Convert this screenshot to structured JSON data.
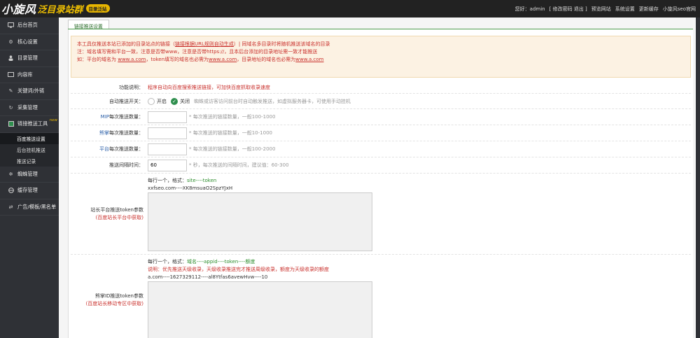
{
  "header": {
    "logo_main": "小旋风",
    "logo_sub": "泛目录站群",
    "logo_badge": "目录泛站",
    "links": [
      "您好：admin",
      "[ 修改密码 退出 ]",
      "预览网站",
      "系统设置",
      "更新缓存",
      "小旋风seo官网"
    ]
  },
  "sidebar": {
    "items": [
      {
        "label": "后台首页",
        "icon": "monitor-icon"
      },
      {
        "label": "核心设置",
        "icon": "cog-icon"
      },
      {
        "label": "目录管理",
        "icon": "user-icon"
      },
      {
        "label": "内容库",
        "icon": "folder-icon"
      },
      {
        "label": "关键词/外链",
        "icon": "key-icon"
      },
      {
        "label": "采集管理",
        "icon": "refresh-icon"
      },
      {
        "label": "链接推送工具",
        "icon": "box-icon",
        "tag": "new"
      }
    ],
    "subitems": [
      "百度推送设置",
      "后台挂机推送",
      "推送记录"
    ],
    "items_after": [
      {
        "label": "蜘蛛管理",
        "icon": "spider-icon"
      },
      {
        "label": "缓存管理",
        "icon": "globe-icon"
      },
      {
        "label": "广告/模板/黑名单",
        "icon": "shuffle-icon"
      }
    ]
  },
  "tab": {
    "label": "链接推送设置"
  },
  "notice": {
    "line1_a": "本工具仅推送本站已添加的目录站点的链接（",
    "line1_link": "链接根据URL规则自动生成",
    "line1_b": "）| 同域名多目录时将随机推送该域名的目录",
    "line2": "注：域名填写需和平台一致，注意是否带www，注意是否带https://，且本后台添加的目录地址需一致才能推送",
    "line3_a": "如：平台的域名为",
    "line3_link1": "www.a.com",
    "line3_b": "，token填写的域名也必需为",
    "line3_link2": "www.a.com",
    "line3_c": "，目录地址的域名也必需为",
    "line3_link3": "www.a.com"
  },
  "form": {
    "desc_label": "功能说明：",
    "desc_value": "程序自动向百度搜索推送链接，可加快百度抓取收录速度",
    "switch_label": "自动推送开关：",
    "switch_on": "开启",
    "switch_off": "关闭",
    "switch_hint": "蜘蛛或访客访问前台时自动触发推送，如虚拟服务器卡，可使用手动挂机",
    "mip_label_prefix": "MIP",
    "mip_label": "每次推送数量：",
    "mip_hint": "* 每次推送的链接数量，一般100-1000",
    "fast_label_prefix": "熊掌",
    "fast_label": "每次推送数量：",
    "fast_hint": "* 每次推送的链接数量，一般10-1000",
    "plat_label_prefix": "平台",
    "plat_label": "每次推送数量：",
    "plat_hint": "* 每次推送的链接数量，一般100-2000",
    "interval_label": "推送间隔时间：",
    "interval_value": "60",
    "interval_hint": "* 秒，每次推送的间隔时间，建议值：60-300",
    "token_label": "站长平台推送token参数",
    "token_sub": "(百度站长平台中获取)",
    "token_format_a": "每行一个，格式：",
    "token_format_b": "site----token",
    "token_example": "xxfseo.com----XK8msuaO2SpzYJxH",
    "xz_label": "熊掌ID推送token参数",
    "xz_sub": "(百度站长移动专区中获取)",
    "xz_format_a": "每行一个，格式：",
    "xz_format_b": "域名----appid----token----额度",
    "xz_note": "说明：优先推送天级收录，天级收录推送完才推送周级收录，额度为天级收录的额度",
    "xz_example": "a.com----1627329112----al8Ytfas6avewHvw----10"
  },
  "colors": {
    "accent": "#2f8f4e",
    "warn": "#c9302c",
    "sidebar": "#2f3136",
    "topbar": "#222222"
  }
}
